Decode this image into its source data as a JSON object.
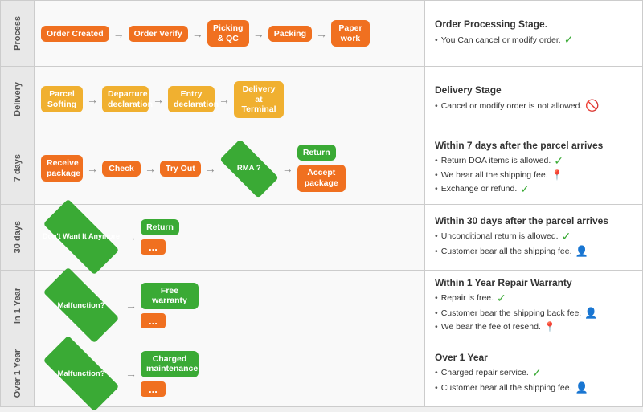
{
  "rows": [
    {
      "label": "Process",
      "steps": [
        "Order\nCreated",
        "Order\nVerify",
        "Picking\n& QC",
        "Packing",
        "Paper\nwork"
      ],
      "info": {
        "title": "Order Processing Stage.",
        "items": [
          {
            "text": "You Can cancel or modify order."
          }
        ]
      }
    },
    {
      "label": "Delivery",
      "steps": [
        "Parcel\nSofting",
        "Departure\ndeclaration",
        "Entry\ndeclaration",
        "Delivery at\nTerminal"
      ],
      "info": {
        "title": "Delivery Stage",
        "items": [
          {
            "text": "Cancel or modify order is not allowed."
          }
        ]
      }
    },
    {
      "label": "7 days",
      "steps": [
        "Receive\npackage",
        "Check",
        "Try Out",
        "RMA ?",
        "Return",
        "Accept\npackage"
      ],
      "info": {
        "title": "Within 7 days after the parcel arrives",
        "items": [
          {
            "text": "Return DOA items is allowed."
          },
          {
            "text": "We bear all the shipping fee."
          },
          {
            "text": "Exchange or refund."
          }
        ]
      }
    },
    {
      "label": "30 days",
      "steps": [
        "Don't Want\nIt Anymore",
        "Return",
        "..."
      ],
      "info": {
        "title": "Within 30 days after the parcel arrives",
        "items": [
          {
            "text": "Unconditional return is allowed."
          },
          {
            "text": "Customer bear all the shipping fee."
          }
        ]
      }
    },
    {
      "label": "In 1 Year",
      "steps": [
        "Malfunction?",
        "Free warranty",
        "..."
      ],
      "info": {
        "title": "Within 1 Year Repair Warranty",
        "items": [
          {
            "text": "Repair is free."
          },
          {
            "text": "Customer bear the shipping back fee."
          },
          {
            "text": "We bear the fee of resend."
          }
        ]
      }
    },
    {
      "label": "Over 1 Year",
      "steps": [
        "Malfunction?",
        "Charged\nmaintenance",
        "..."
      ],
      "info": {
        "title": "Over 1 Year",
        "items": [
          {
            "text": "Charged repair service."
          },
          {
            "text": "Customer bear all the shipping fee."
          }
        ]
      }
    }
  ]
}
